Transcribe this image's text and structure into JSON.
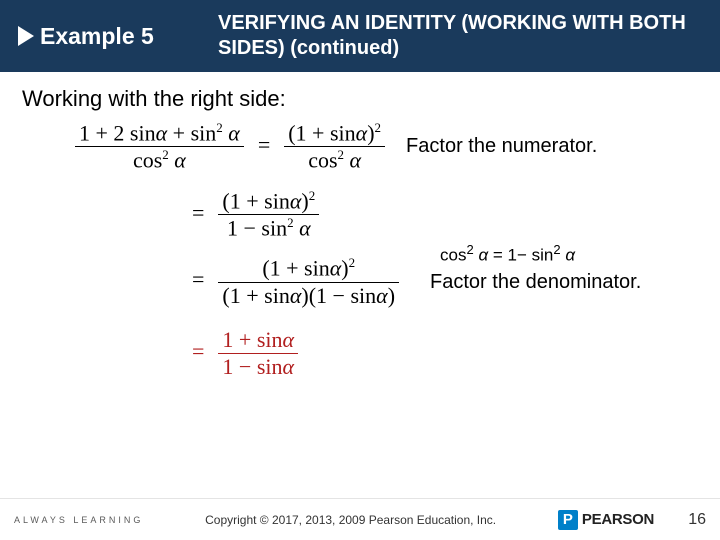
{
  "header": {
    "example_label": "Example 5",
    "title": "VERIFYING AN IDENTITY (WORKING WITH BOTH SIDES) (continued)"
  },
  "intro": "Working with the right side:",
  "notes": {
    "factor_num": "Factor the numerator.",
    "factor_denom": "Factor the denominator.",
    "cos_identity_lhs": "cos",
    "cos_identity_rhs_prefix": " = 1− sin",
    "alpha": "α",
    "sq": "2"
  },
  "footer": {
    "always_learning": "ALWAYS LEARNING",
    "copyright": "Copyright © 2017, 2013, 2009 Pearson Education, Inc.",
    "pearson": "PEARSON",
    "page": "16"
  }
}
